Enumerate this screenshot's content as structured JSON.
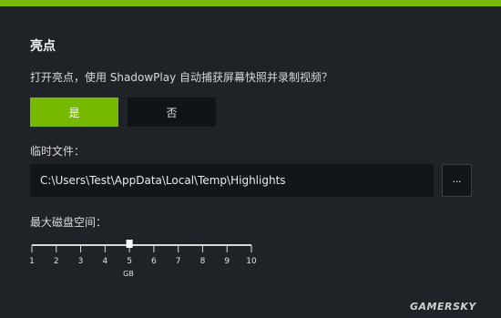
{
  "panel": {
    "title": "亮点",
    "question": "打开亮点，使用 ShadowPlay 自动捕获屏幕快照并录制视频？"
  },
  "buttons": {
    "yes_label": "是",
    "no_label": "否"
  },
  "temp_files": {
    "label": "临时文件：",
    "path_value": "C:\\Users\\Test\\AppData\\Local\\Temp\\Highlights",
    "browse_label": "..."
  },
  "disk_space": {
    "label": "最大磁盘空间：",
    "ticks": [
      "1",
      "2",
      "3",
      "4",
      "5",
      "6",
      "7",
      "8",
      "9",
      "10"
    ],
    "unit": "GB",
    "min": 1,
    "max": 10,
    "value": 5
  },
  "watermark": "GAMERSKY",
  "colors": {
    "accent": "#76b900",
    "background": "#1f2327",
    "field": "#131618"
  }
}
